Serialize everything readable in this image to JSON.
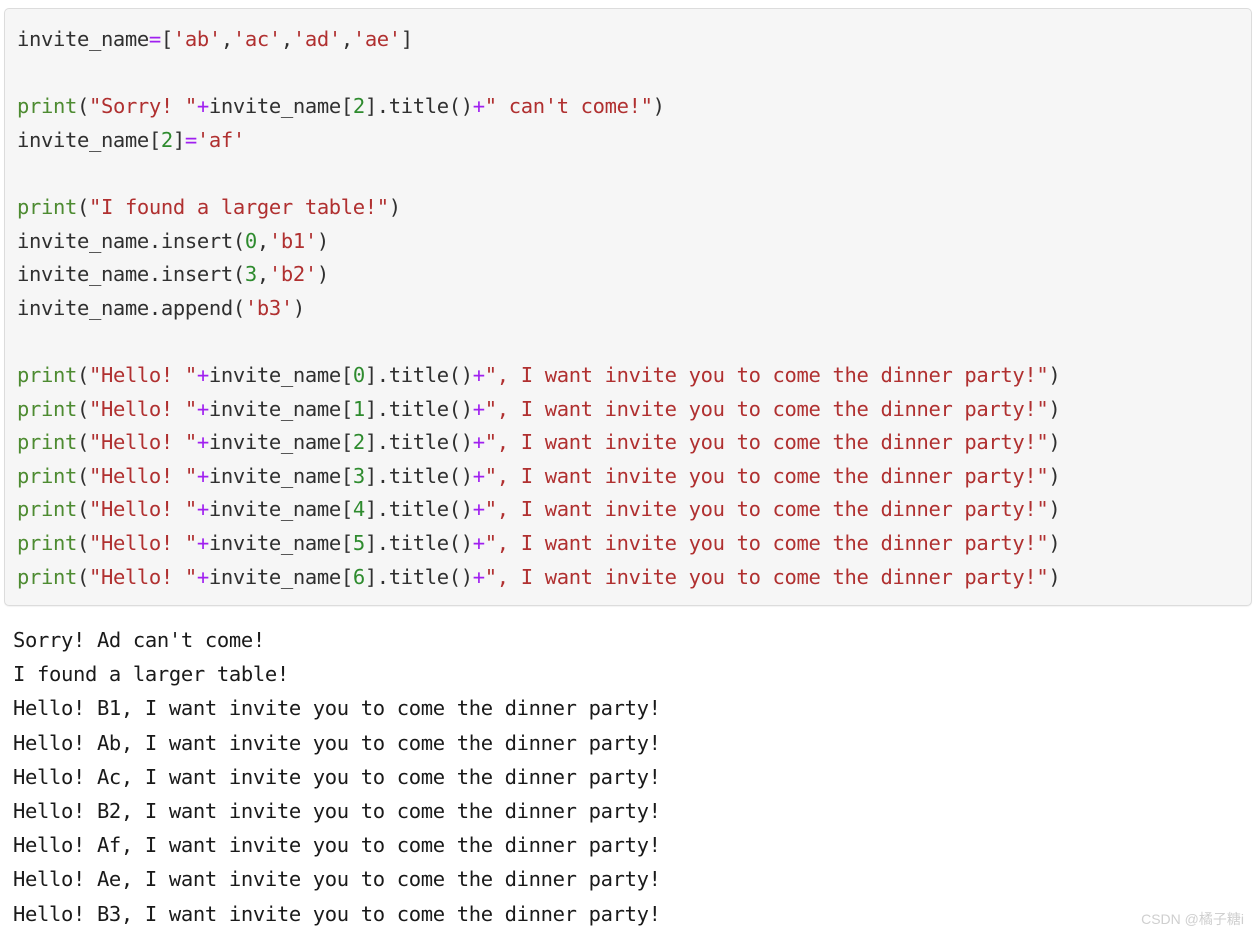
{
  "theme": {
    "code_background": "#f6f6f6",
    "code_border": "#dcdcdc",
    "page_background": "#ffffff",
    "function_color": "#4d8b31",
    "string_color": "#b03030",
    "number_color": "#2e8b2e",
    "operator_color": "#a020f0",
    "identifier_color": "#303030",
    "output_color": "#1a1a1a",
    "watermark_color": "#cfcfcf"
  },
  "code": {
    "language": "python",
    "lines": [
      {
        "n": 1,
        "text": "invite_name=['ab','ac','ad','ae']",
        "tokens": [
          {
            "t": "invite_name",
            "c": "t-plain"
          },
          {
            "t": "=",
            "c": "t-op"
          },
          {
            "t": "[",
            "c": "t-punct"
          },
          {
            "t": "'ab'",
            "c": "t-str"
          },
          {
            "t": ",",
            "c": "t-punct"
          },
          {
            "t": "'ac'",
            "c": "t-str"
          },
          {
            "t": ",",
            "c": "t-punct"
          },
          {
            "t": "'ad'",
            "c": "t-str"
          },
          {
            "t": ",",
            "c": "t-punct"
          },
          {
            "t": "'ae'",
            "c": "t-str"
          },
          {
            "t": "]",
            "c": "t-punct"
          }
        ]
      },
      {
        "n": 2,
        "text": "",
        "tokens": []
      },
      {
        "n": 3,
        "text": "print(\"Sorry! \"+invite_name[2].title()+\" can't come!\")",
        "tokens": [
          {
            "t": "print",
            "c": "t-fn"
          },
          {
            "t": "(",
            "c": "t-punct"
          },
          {
            "t": "\"Sorry! \"",
            "c": "t-str"
          },
          {
            "t": "+",
            "c": "t-op"
          },
          {
            "t": "invite_name[",
            "c": "t-plain"
          },
          {
            "t": "2",
            "c": "t-num"
          },
          {
            "t": "].title()",
            "c": "t-plain"
          },
          {
            "t": "+",
            "c": "t-op"
          },
          {
            "t": "\" can't come!\"",
            "c": "t-str"
          },
          {
            "t": ")",
            "c": "t-punct"
          }
        ]
      },
      {
        "n": 4,
        "text": "invite_name[2]='af'",
        "tokens": [
          {
            "t": "invite_name[",
            "c": "t-plain"
          },
          {
            "t": "2",
            "c": "t-num"
          },
          {
            "t": "]",
            "c": "t-plain"
          },
          {
            "t": "=",
            "c": "t-op"
          },
          {
            "t": "'af'",
            "c": "t-str"
          }
        ]
      },
      {
        "n": 5,
        "text": "",
        "tokens": []
      },
      {
        "n": 6,
        "text": "print(\"I found a larger table!\")",
        "tokens": [
          {
            "t": "print",
            "c": "t-fn"
          },
          {
            "t": "(",
            "c": "t-punct"
          },
          {
            "t": "\"I found a larger table!\"",
            "c": "t-str"
          },
          {
            "t": ")",
            "c": "t-punct"
          }
        ]
      },
      {
        "n": 7,
        "text": "invite_name.insert(0,'b1')",
        "tokens": [
          {
            "t": "invite_name.insert(",
            "c": "t-plain"
          },
          {
            "t": "0",
            "c": "t-num"
          },
          {
            "t": ",",
            "c": "t-punct"
          },
          {
            "t": "'b1'",
            "c": "t-str"
          },
          {
            "t": ")",
            "c": "t-punct"
          }
        ]
      },
      {
        "n": 8,
        "text": "invite_name.insert(3,'b2')",
        "tokens": [
          {
            "t": "invite_name.insert(",
            "c": "t-plain"
          },
          {
            "t": "3",
            "c": "t-num"
          },
          {
            "t": ",",
            "c": "t-punct"
          },
          {
            "t": "'b2'",
            "c": "t-str"
          },
          {
            "t": ")",
            "c": "t-punct"
          }
        ]
      },
      {
        "n": 9,
        "text": "invite_name.append('b3')",
        "tokens": [
          {
            "t": "invite_name.append(",
            "c": "t-plain"
          },
          {
            "t": "'b3'",
            "c": "t-str"
          },
          {
            "t": ")",
            "c": "t-punct"
          }
        ]
      },
      {
        "n": 10,
        "text": "",
        "tokens": []
      },
      {
        "n": 11,
        "text": "print(\"Hello! \"+invite_name[0].title()+\", I want invite you to come the dinner party!\")",
        "tokens": [
          {
            "t": "print",
            "c": "t-fn"
          },
          {
            "t": "(",
            "c": "t-punct"
          },
          {
            "t": "\"Hello! \"",
            "c": "t-str"
          },
          {
            "t": "+",
            "c": "t-op"
          },
          {
            "t": "invite_name[",
            "c": "t-plain"
          },
          {
            "t": "0",
            "c": "t-num"
          },
          {
            "t": "].title()",
            "c": "t-plain"
          },
          {
            "t": "+",
            "c": "t-op"
          },
          {
            "t": "\", I want invite you to come the dinner party!\"",
            "c": "t-str"
          },
          {
            "t": ")",
            "c": "t-punct"
          }
        ]
      },
      {
        "n": 12,
        "text": "print(\"Hello! \"+invite_name[1].title()+\", I want invite you to come the dinner party!\")",
        "tokens": [
          {
            "t": "print",
            "c": "t-fn"
          },
          {
            "t": "(",
            "c": "t-punct"
          },
          {
            "t": "\"Hello! \"",
            "c": "t-str"
          },
          {
            "t": "+",
            "c": "t-op"
          },
          {
            "t": "invite_name[",
            "c": "t-plain"
          },
          {
            "t": "1",
            "c": "t-num"
          },
          {
            "t": "].title()",
            "c": "t-plain"
          },
          {
            "t": "+",
            "c": "t-op"
          },
          {
            "t": "\", I want invite you to come the dinner party!\"",
            "c": "t-str"
          },
          {
            "t": ")",
            "c": "t-punct"
          }
        ]
      },
      {
        "n": 13,
        "text": "print(\"Hello! \"+invite_name[2].title()+\", I want invite you to come the dinner party!\")",
        "tokens": [
          {
            "t": "print",
            "c": "t-fn"
          },
          {
            "t": "(",
            "c": "t-punct"
          },
          {
            "t": "\"Hello! \"",
            "c": "t-str"
          },
          {
            "t": "+",
            "c": "t-op"
          },
          {
            "t": "invite_name[",
            "c": "t-plain"
          },
          {
            "t": "2",
            "c": "t-num"
          },
          {
            "t": "].title()",
            "c": "t-plain"
          },
          {
            "t": "+",
            "c": "t-op"
          },
          {
            "t": "\", I want invite you to come the dinner party!\"",
            "c": "t-str"
          },
          {
            "t": ")",
            "c": "t-punct"
          }
        ]
      },
      {
        "n": 14,
        "text": "print(\"Hello! \"+invite_name[3].title()+\", I want invite you to come the dinner party!\")",
        "tokens": [
          {
            "t": "print",
            "c": "t-fn"
          },
          {
            "t": "(",
            "c": "t-punct"
          },
          {
            "t": "\"Hello! \"",
            "c": "t-str"
          },
          {
            "t": "+",
            "c": "t-op"
          },
          {
            "t": "invite_name[",
            "c": "t-plain"
          },
          {
            "t": "3",
            "c": "t-num"
          },
          {
            "t": "].title()",
            "c": "t-plain"
          },
          {
            "t": "+",
            "c": "t-op"
          },
          {
            "t": "\", I want invite you to come the dinner party!\"",
            "c": "t-str"
          },
          {
            "t": ")",
            "c": "t-punct"
          }
        ]
      },
      {
        "n": 15,
        "text": "print(\"Hello! \"+invite_name[4].title()+\", I want invite you to come the dinner party!\")",
        "tokens": [
          {
            "t": "print",
            "c": "t-fn"
          },
          {
            "t": "(",
            "c": "t-punct"
          },
          {
            "t": "\"Hello! \"",
            "c": "t-str"
          },
          {
            "t": "+",
            "c": "t-op"
          },
          {
            "t": "invite_name[",
            "c": "t-plain"
          },
          {
            "t": "4",
            "c": "t-num"
          },
          {
            "t": "].title()",
            "c": "t-plain"
          },
          {
            "t": "+",
            "c": "t-op"
          },
          {
            "t": "\", I want invite you to come the dinner party!\"",
            "c": "t-str"
          },
          {
            "t": ")",
            "c": "t-punct"
          }
        ]
      },
      {
        "n": 16,
        "text": "print(\"Hello! \"+invite_name[5].title()+\", I want invite you to come the dinner party!\")",
        "tokens": [
          {
            "t": "print",
            "c": "t-fn"
          },
          {
            "t": "(",
            "c": "t-punct"
          },
          {
            "t": "\"Hello! \"",
            "c": "t-str"
          },
          {
            "t": "+",
            "c": "t-op"
          },
          {
            "t": "invite_name[",
            "c": "t-plain"
          },
          {
            "t": "5",
            "c": "t-num"
          },
          {
            "t": "].title()",
            "c": "t-plain"
          },
          {
            "t": "+",
            "c": "t-op"
          },
          {
            "t": "\", I want invite you to come the dinner party!\"",
            "c": "t-str"
          },
          {
            "t": ")",
            "c": "t-punct"
          }
        ]
      },
      {
        "n": 17,
        "text": "print(\"Hello! \"+invite_name[6].title()+\", I want invite you to come the dinner party!\")",
        "tokens": [
          {
            "t": "print",
            "c": "t-fn"
          },
          {
            "t": "(",
            "c": "t-punct"
          },
          {
            "t": "\"Hello! \"",
            "c": "t-str"
          },
          {
            "t": "+",
            "c": "t-op"
          },
          {
            "t": "invite_name[",
            "c": "t-plain"
          },
          {
            "t": "6",
            "c": "t-num"
          },
          {
            "t": "].title()",
            "c": "t-plain"
          },
          {
            "t": "+",
            "c": "t-op"
          },
          {
            "t": "\", I want invite you to come the dinner party!\"",
            "c": "t-str"
          },
          {
            "t": ")",
            "c": "t-punct"
          }
        ]
      }
    ]
  },
  "output": {
    "lines": [
      "Sorry! Ad can't come!",
      "I found a larger table!",
      "Hello! B1, I want invite you to come the dinner party!",
      "Hello! Ab, I want invite you to come the dinner party!",
      "Hello! Ac, I want invite you to come the dinner party!",
      "Hello! B2, I want invite you to come the dinner party!",
      "Hello! Af, I want invite you to come the dinner party!",
      "Hello! Ae, I want invite you to come the dinner party!",
      "Hello! B3, I want invite you to come the dinner party!"
    ]
  },
  "watermark": {
    "text": "CSDN @橘子糖i"
  }
}
